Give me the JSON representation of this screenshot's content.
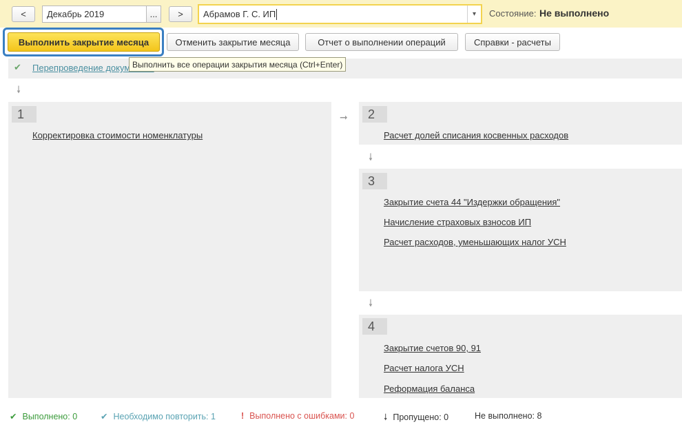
{
  "header": {
    "prev_label": "<",
    "period_value": "Декабрь 2019",
    "period_picker_label": "...",
    "next_label": ">",
    "organization_value": "Абрамов Г. С. ИП",
    "dropdown_label": "▾",
    "status_label": "Состояние:",
    "status_value": "Не выполнено"
  },
  "toolbar": {
    "run_label": "Выполнить закрытие месяца",
    "cancel_label": "Отменить закрытие месяца",
    "report_label": "Отчет о выполнении операций",
    "help_label": "Справки - расчеты"
  },
  "tooltip": "Выполнить все операции закрытия месяца (Ctrl+Enter)",
  "repost": {
    "label": "Перепроведение документов"
  },
  "stages": [
    {
      "number": "1",
      "operations": [
        "Корректировка стоимости номенклатуры"
      ]
    },
    {
      "number": "2",
      "operations": [
        "Расчет долей списания косвенных расходов"
      ]
    },
    {
      "number": "3",
      "operations": [
        "Закрытие счета 44 \"Издержки обращения\"",
        "Начисление страховых взносов ИП",
        "Расчет расходов, уменьшающих налог УСН"
      ]
    },
    {
      "number": "4",
      "operations": [
        "Закрытие счетов 90, 91",
        "Расчет налога УСН",
        "Реформация баланса"
      ]
    }
  ],
  "legend": {
    "done": "Выполнено: 0",
    "repeat": "Необходимо повторить: 1",
    "errors": "Выполнено с ошибками: 0",
    "skipped": "Пропущено: 0",
    "not_done": "Не выполнено: 8"
  },
  "colors": {
    "topbar_bg": "#fbf3c6",
    "primary_button": "#f3c51b",
    "focus_border": "#3a7fc2",
    "done": "#3b9b3b",
    "repeat": "#5aa3b3",
    "errors": "#d9534f"
  }
}
